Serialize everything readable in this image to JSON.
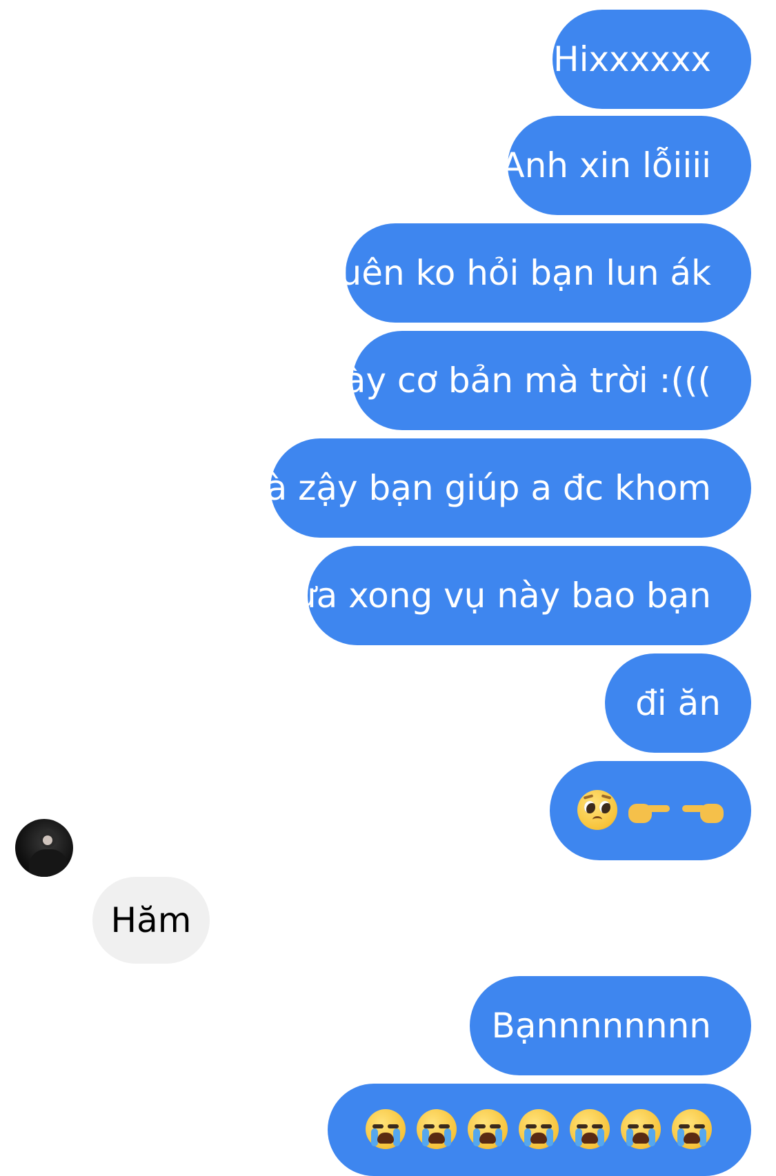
{
  "messages": {
    "m1": "Hixxxxxx",
    "m2": "Anh xin lỗiiii",
    "m3": "quên ko hỏi bạn lun ák",
    "m4": "này cơ bản mà trời :(((",
    "m5": "mà zậy bạn giúp a đc khom",
    "m6": "hứa xong vụ này bao bạn",
    "m7": "đi ăn",
    "m8_emojis": [
      "pleading-face",
      "right-pointing-hand",
      "left-pointing-hand"
    ],
    "incoming": "Hăm",
    "m9": "Bạnnnnnnnn",
    "m10_emojis": [
      "loudly-crying-face",
      "loudly-crying-face",
      "loudly-crying-face",
      "loudly-crying-face",
      "loudly-crying-face",
      "loudly-crying-face",
      "loudly-crying-face"
    ]
  },
  "colors": {
    "outgoing_bubble": "#3e86ef",
    "incoming_bubble": "#f0f0f0"
  }
}
